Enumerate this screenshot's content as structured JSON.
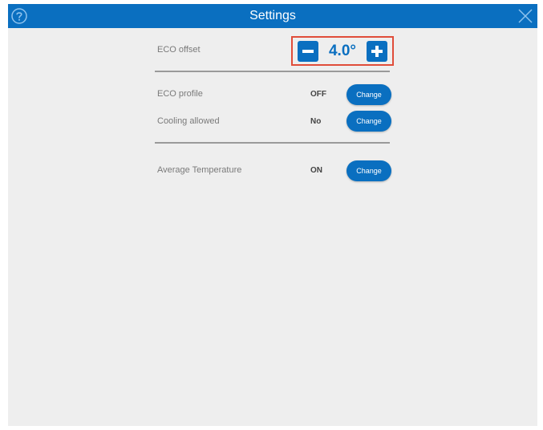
{
  "header": {
    "title": "Settings",
    "help_icon": "help-circle-icon",
    "close_icon": "close-icon"
  },
  "eco_offset": {
    "label": "ECO offset",
    "value": "4.0°",
    "decrease_icon": "minus-icon",
    "increase_icon": "plus-icon",
    "highlight_color": "#e04d3a"
  },
  "settings": [
    {
      "label": "ECO profile",
      "value": "OFF",
      "button": "Change"
    },
    {
      "label": "Cooling allowed",
      "value": "No",
      "button": "Change"
    },
    {
      "label": "Average Temperature",
      "value": "ON",
      "button": "Change"
    }
  ],
  "colors": {
    "accent": "#0a6fc0",
    "background": "#eeeeee",
    "highlight": "#e04d3a"
  }
}
